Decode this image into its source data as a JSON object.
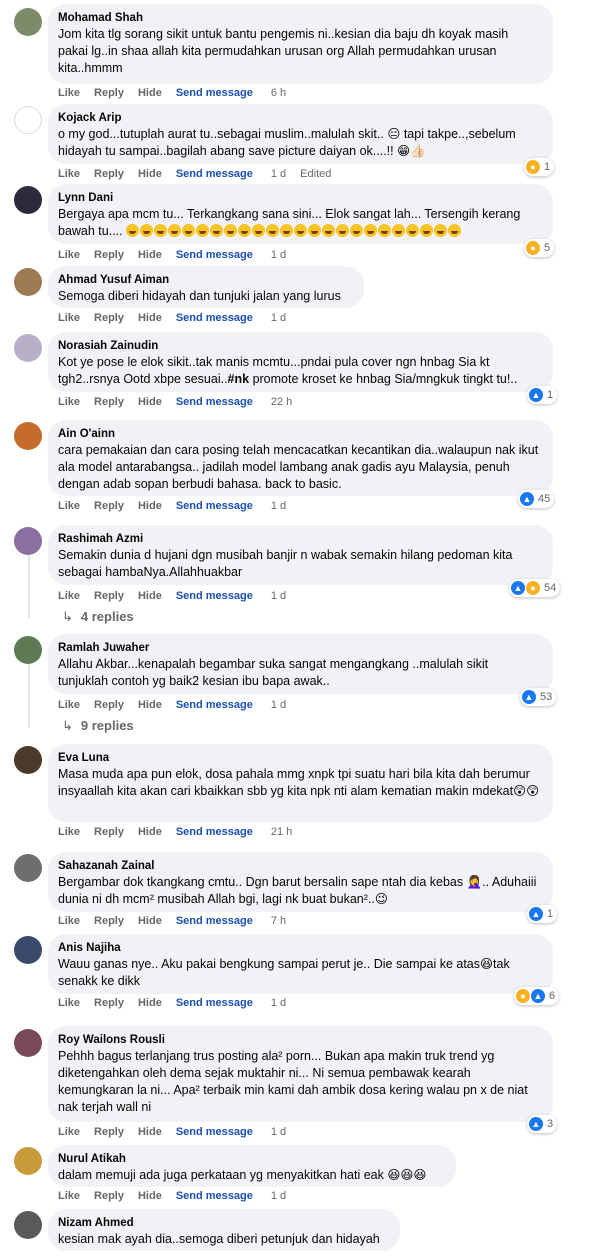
{
  "actions": {
    "like": "Like",
    "reply": "Reply",
    "hide": "Hide",
    "send": "Send message",
    "edited": "Edited"
  },
  "comments": [
    {
      "name": "Mohamad Shah",
      "text": "Jom kita tlg sorang sikit untuk bantu pengemis ni..kesian dia baju dh koyak masih pakai lg..in shaa allah kita permudahkan urusan org Allah permudahkan urusan kita..hmmm",
      "time": "6 h",
      "avatar": "#7d8b6a"
    },
    {
      "name": "Kojack Arip",
      "text": "o my god...tutuplah aurat tu..sebagai muslim..malulah skit.. 😑 tapi takpe..,sebelum hidayah tu sampai..bagilah abang save picture daiyan ok....!! 😁👍🏻",
      "time": "1 d",
      "edited": true,
      "react_count": "1",
      "avatar": "#ffffff"
    },
    {
      "name": "Lynn Dani",
      "text": "Bergaya apa mcm tu... Terkangkang sana sini... Elok sangat lah... Tersengih kerang bawah tu....",
      "time": "1 d",
      "react_count": "5",
      "avatar": "#2b2b3a"
    },
    {
      "name": "Ahmad Yusuf Aiman",
      "text": "Semoga diberi hidayah dan tunjuki jalan yang lurus",
      "time": "1 d",
      "avatar": "#9c7b52"
    },
    {
      "name": "Norasiah Zainudin",
      "text_pre": "Kot ye pose le elok sikit..tak manis mcmtu...pndai pula cover ngn hnbag Sia kt tgh2..rsnya Ootd xbpe sesuai..",
      "text_bold": "#nk",
      "text_post": " promote kroset ke hnbag Sia/mngkuk tingkt tu!..",
      "time": "22 h",
      "react_count": "1",
      "avatar": "#b8b0c8"
    },
    {
      "name": "Ain O'ainn",
      "text": "cara pemakaian dan cara posing telah mencacatkan kecantikan dia..walaupun nak ikut ala model antarabangsa.. jadilah model lambang anak gadis ayu Malaysia, penuh dengan adab sopan berbudi bahasa. back to basic.",
      "time": "1 d",
      "react_count": "45",
      "avatar": "#c46a2a"
    },
    {
      "name": "Rashimah Azmi",
      "text": "Semakin dunia d hujani dgn musibah banjir n wabak semakin hilang pedoman kita sebagai hambaNya.Allahhuakbar",
      "time": "1 d",
      "react_count": "54",
      "replies": "4 replies",
      "avatar": "#8a6fa0"
    },
    {
      "name": "Ramlah Juwaher",
      "text": "Allahu Akbar...kenapalah begambar suka sangat mengangkang ..malulah sikit tunjuklah contoh yg baik2 kesian ibu bapa awak..",
      "time": "1 d",
      "react_count": "53",
      "replies": "9 replies",
      "avatar": "#5f7a55"
    },
    {
      "name": "Eva Luna",
      "text": "Masa muda apa pun elok, dosa pahala mmg xnpk tpi suatu hari bila kita dah berumur insyaallah kita akan cari kbaikkan sbb yg kita npk nti alam kematian makin mdekat😲😲",
      "time": "21 h",
      "avatar": "#4a3a2a"
    },
    {
      "name": "Sahazanah Zainal",
      "text": "Bergambar dok tkangkang cmtu.. Dgn barut bersalin sape ntah dia kebas 🤦‍♀️.. Aduhaiii dunia ni dh mcm² musibah Allah bgi, lagi nk buat bukan²..😉",
      "time": "7 h",
      "react_count": "1",
      "avatar": "#6e6e6e"
    },
    {
      "name": "Anis Najiha",
      "text": "Wauu ganas nye.. Aku pakai bengkung sampai perut je.. Die sampai ke atas😆tak senakk ke dikk",
      "time": "1 d",
      "react_count": "6",
      "avatar": "#3a4a6a"
    },
    {
      "name": "Roy Wailons Rousli",
      "text": "Pehhh bagus terlanjang trus posting ala² porn... Bukan apa makin truk trend yg diketengahkan oleh dema sejak muktahir ni... Ni semua pembawak kearah kemungkaran la ni... Apa² terbaik min kami dah ambik dosa kering walau pn x de niat nak terjah wall ni",
      "time": "1 d",
      "react_count": "3",
      "avatar": "#7a4a5a"
    },
    {
      "name": "Nurul Atikah",
      "text": "dalam memuji ada juga perkataan yg menyakitkan hati eak 😆😆😆",
      "time": "1 d",
      "avatar": "#c89a3a"
    },
    {
      "name": "Nizam Ahmed",
      "text": "kesian mak ayah dia..semoga diberi petunjuk dan hidayah",
      "avatar": "#5a5a5a"
    }
  ]
}
